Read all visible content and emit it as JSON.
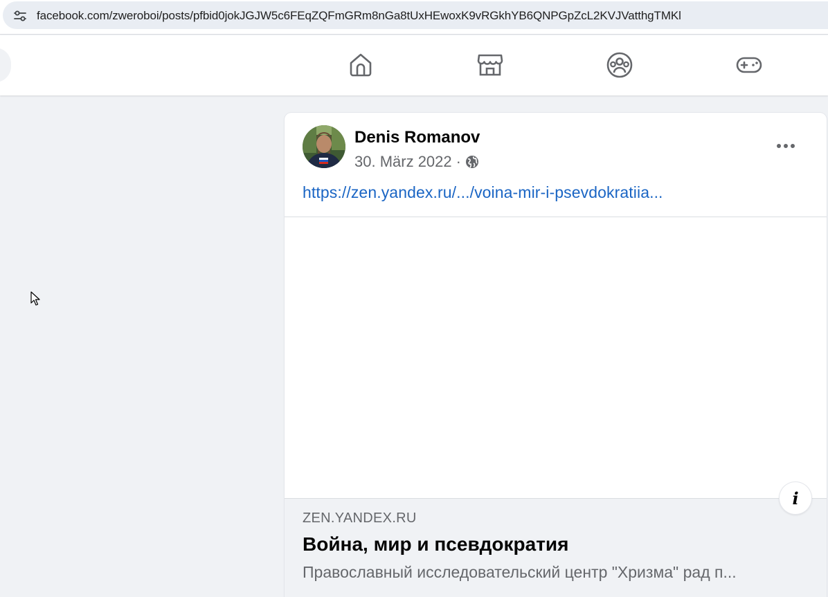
{
  "browser": {
    "url": "facebook.com/zweroboi/posts/pfbid0jokJGJW5c6FEqZQFmGRm8nGa8tUxHEwoxK9vRGkhYB6QNPGpZcL2KVJVatthgTMKl",
    "site_info_icon": "site-info-icon"
  },
  "nav": {
    "icons": [
      "home-icon",
      "marketplace-icon",
      "groups-icon",
      "gaming-icon"
    ]
  },
  "post": {
    "author": "Denis Romanov",
    "date": "30. März 2022",
    "separator": "·",
    "privacy_icon": "globe-icon",
    "link_text": "https://zen.yandex.ru/.../voina-mir-i-psevdokratiia...",
    "preview": {
      "domain": "ZEN.YANDEX.RU",
      "title": "Война, мир и псевдократия",
      "description": "Православный исследовательский центр \"Хризма\" рад п..."
    },
    "info_label": "i"
  },
  "colors": {
    "link": "#1a65c4",
    "secondary_text": "#65676b",
    "page_bg": "#f0f2f5"
  }
}
